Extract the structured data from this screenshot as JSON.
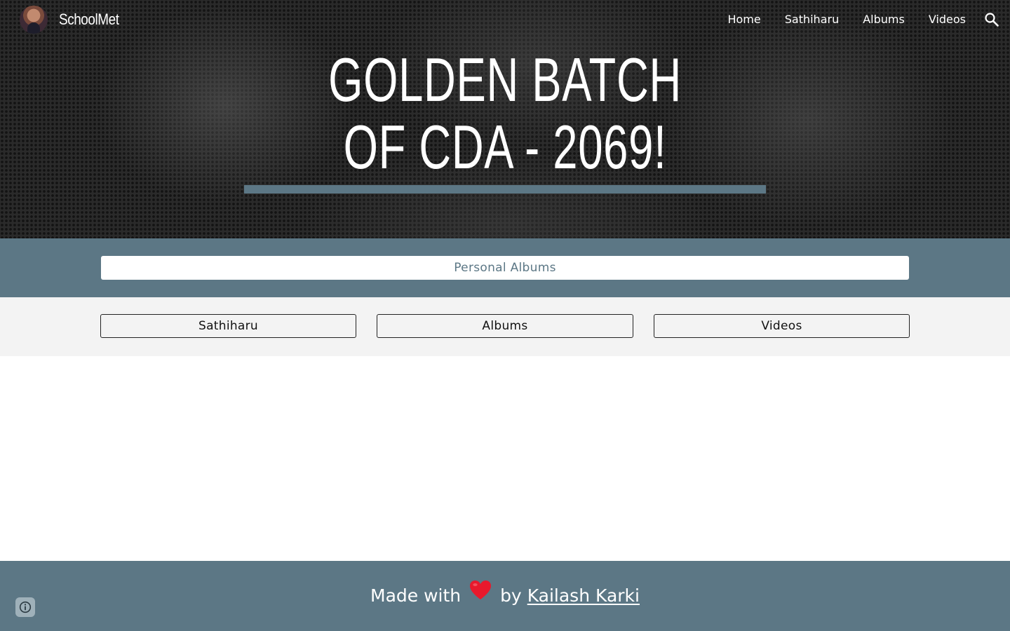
{
  "header": {
    "site_title": "SchoolMet",
    "nav": [
      {
        "label": "Home"
      },
      {
        "label": "Sathiharu"
      },
      {
        "label": "Albums"
      },
      {
        "label": "Videos"
      }
    ],
    "search_icon": "search-icon",
    "avatar_icon": "profile-photo"
  },
  "hero": {
    "title_line1": "GOLDEN BATCH",
    "title_line2": "OF CDA - 2069!"
  },
  "albums_section": {
    "label": "Personal Albums"
  },
  "buttons": [
    {
      "label": "Sathiharu"
    },
    {
      "label": "Albums"
    },
    {
      "label": "Videos"
    }
  ],
  "footer": {
    "made_with": "Made with",
    "by": "by",
    "author": "Kailash Karki",
    "heart_icon": "heart-emoji",
    "info_icon": "info-icon"
  },
  "colors": {
    "accent": "#5c7785",
    "hero_bg": "#2a2a2a",
    "button_row_bg": "#f3f3f3",
    "heart": "#e8192c"
  }
}
